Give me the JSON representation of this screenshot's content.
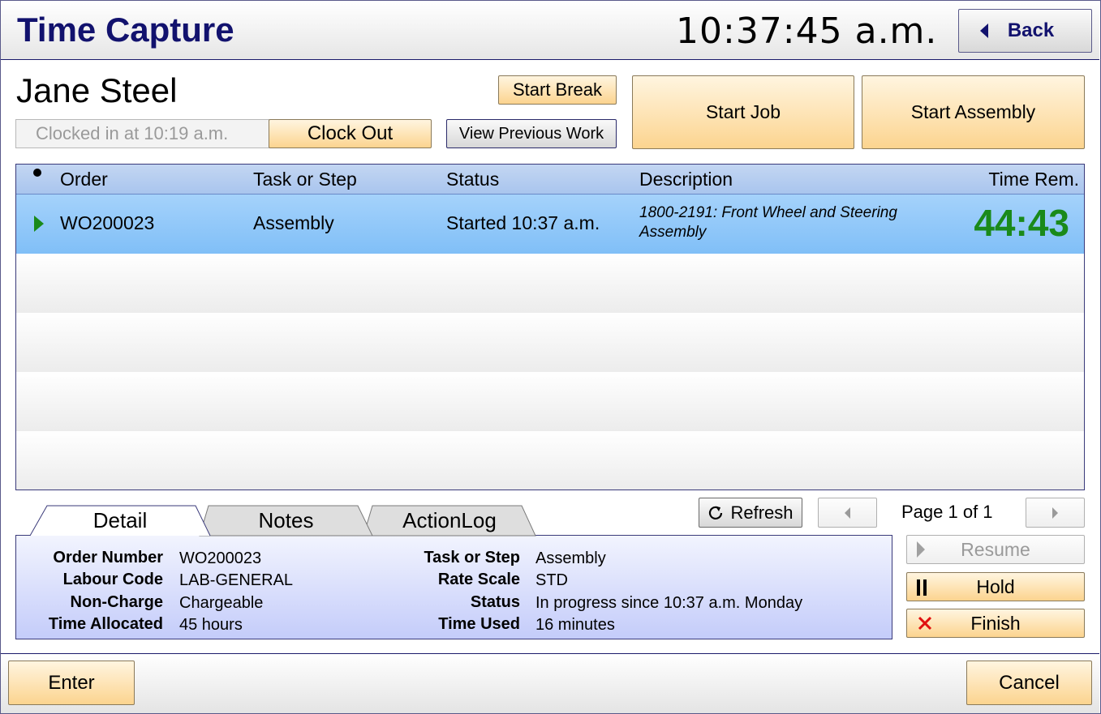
{
  "header": {
    "title": "Time Capture",
    "clock": "10:37:45 a.m.",
    "back_label": "Back"
  },
  "user": {
    "name": "Jane Steel",
    "clocked_in_text": "Clocked in at 10:19 a.m."
  },
  "actions": {
    "clock_out": "Clock Out",
    "start_break": "Start Break",
    "view_previous": "View Previous Work",
    "start_job": "Start Job",
    "start_assembly": "Start Assembly"
  },
  "grid": {
    "columns": {
      "order": "Order",
      "task": "Task or Step",
      "status": "Status",
      "description": "Description",
      "time_rem": "Time Rem."
    },
    "rows": [
      {
        "order": "WO200023",
        "task": "Assembly",
        "status": "Started 10:37 a.m.",
        "description": "1800-2191: Front Wheel and Steering Assembly",
        "time_rem": "44:43"
      }
    ]
  },
  "tabs": [
    "Detail",
    "Notes",
    "ActionLog"
  ],
  "detail": {
    "labels": {
      "order_number": "Order Number",
      "labour_code": "Labour Code",
      "non_charge": "Non-Charge",
      "time_allocated": "Time Allocated",
      "task_or_step": "Task or Step",
      "rate_scale": "Rate Scale",
      "status": "Status",
      "time_used": "Time Used"
    },
    "values": {
      "order_number": "WO200023",
      "labour_code": "LAB-GENERAL",
      "non_charge": "Chargeable",
      "time_allocated": "45 hours",
      "task_or_step": "Assembly",
      "rate_scale": "STD",
      "status": "In progress since 10:37 a.m. Monday",
      "time_used": "16 minutes"
    }
  },
  "paging": {
    "refresh": "Refresh",
    "page_label": "Page 1 of 1"
  },
  "controls": {
    "resume": "Resume",
    "hold": "Hold",
    "finish": "Finish"
  },
  "footer": {
    "enter": "Enter",
    "cancel": "Cancel"
  },
  "colors": {
    "title": "#12126e",
    "accent_orange": "#fcd48f",
    "time_remaining": "#1a8a1a",
    "finish_icon": "#e01010"
  }
}
